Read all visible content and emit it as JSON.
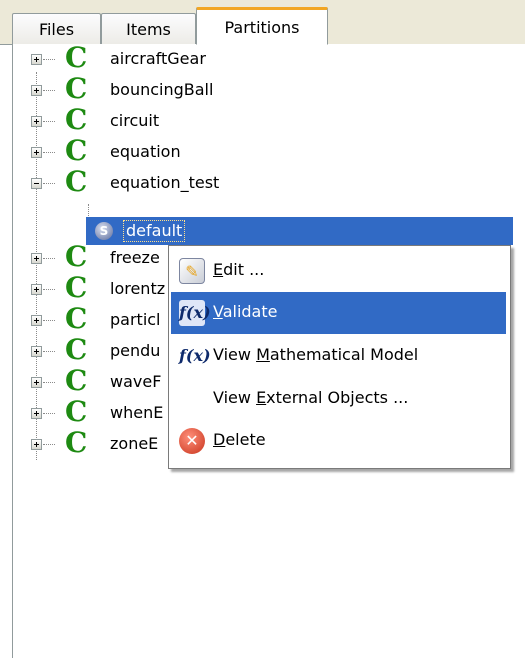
{
  "tabs": [
    {
      "label": "Files"
    },
    {
      "label": "Items"
    },
    {
      "label": "Partitions"
    }
  ],
  "active_tab": "Partitions",
  "tree": {
    "items": [
      {
        "label": "aircraftGear",
        "expanded": false
      },
      {
        "label": "bouncingBall",
        "expanded": false
      },
      {
        "label": "circuit",
        "expanded": false
      },
      {
        "label": "equation",
        "expanded": false
      },
      {
        "label": "equation_test",
        "expanded": true
      },
      {
        "label": "freezeE",
        "expanded": false
      },
      {
        "label": "lorentz",
        "expanded": false
      },
      {
        "label": "particle",
        "expanded": false
      },
      {
        "label": "pendulum",
        "expanded": false
      },
      {
        "label": "waveR",
        "expanded": false
      },
      {
        "label": "whenE",
        "expanded": false
      },
      {
        "label": "zoneE",
        "expanded": false
      }
    ],
    "visible_labels": [
      "aircraftGear",
      "bouncingBall",
      "circuit",
      "equation",
      "equation_test",
      "freeze",
      "lorentz",
      "particl",
      "pendu",
      "waveF",
      "whenE",
      "zoneE"
    ],
    "selected_child": {
      "label": "default",
      "icon": "partition-icon"
    }
  },
  "context_menu": {
    "items": [
      {
        "accel": "E",
        "rest": "dit ...",
        "icon": "edit-icon",
        "highlighted": false
      },
      {
        "accel": "V",
        "rest": "alidate",
        "icon": "fx-validate-icon",
        "highlighted": true
      },
      {
        "pre": "View ",
        "accel": "M",
        "rest": "athematical Model",
        "icon": "fx-icon",
        "highlighted": false
      },
      {
        "pre": "View ",
        "accel": "E",
        "rest": "xternal Objects ...",
        "icon": "",
        "highlighted": false
      },
      {
        "accel": "D",
        "rest": "elete",
        "icon": "delete-icon",
        "highlighted": false
      }
    ]
  },
  "colors": {
    "selection": "#316ac5",
    "class_icon": "#1e8a12",
    "active_tab_accent": "#f2a623"
  }
}
